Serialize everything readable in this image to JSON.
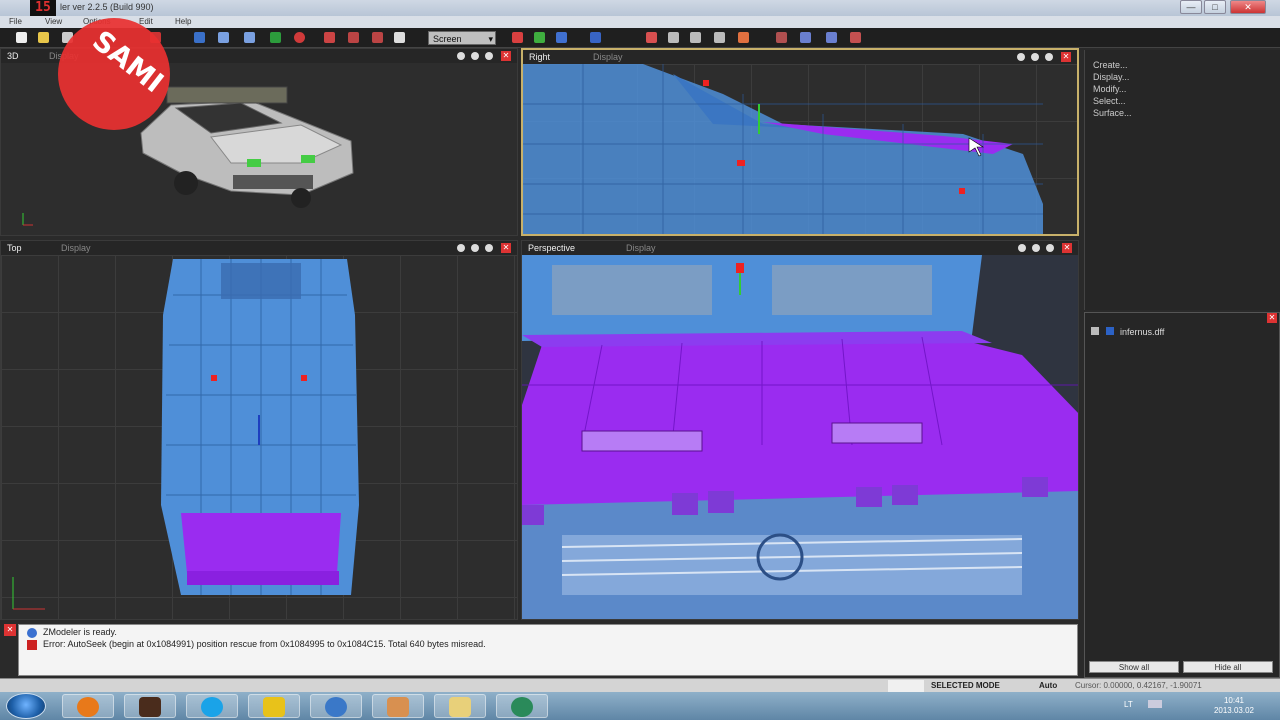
{
  "window": {
    "app_logo": "15",
    "title": "ler ver 2.2.5 (Build 990)",
    "controls": {
      "minimize": "—",
      "maximize": "□",
      "close": "✕"
    }
  },
  "menu": {
    "items": [
      "File",
      "View",
      "Options",
      "Edit",
      "Help"
    ]
  },
  "toolbar": {
    "screen_select": "Screen"
  },
  "viewports": {
    "v3d": {
      "name": "3D",
      "display": "Display"
    },
    "right": {
      "name": "Right",
      "display": "Display"
    },
    "top": {
      "name": "Top",
      "display": "Display"
    },
    "perspective": {
      "name": "Perspective",
      "display": "Display"
    }
  },
  "command_panel": {
    "items": [
      "Create...",
      "Display...",
      "Modify...",
      "Select...",
      "Surface..."
    ]
  },
  "scene_tree": {
    "file": "infernus.dff",
    "show_all": "Show all",
    "hide_all": "Hide all"
  },
  "log": {
    "lines": [
      "ZModeler is ready.",
      "Error: AutoSeek (begin at 0x1084991) position rescue from 0x1084995 to 0x1084C15. Total 640 bytes misread."
    ]
  },
  "status": {
    "mode": "SELECTED MODE",
    "auto": "Auto",
    "cursor": "Cursor: 0.00000, 0.42167, -1.90071"
  },
  "taskbar": {
    "lang": "LT",
    "time": "10:41",
    "date": "2013.03.02"
  },
  "overlay": {
    "badge": "SAMI"
  },
  "colors": {
    "wire_blue": "#4f8fd8",
    "wire_purple": "#9a2cf0",
    "accent_red": "#e83030",
    "selected_border": "#c8b16a"
  }
}
